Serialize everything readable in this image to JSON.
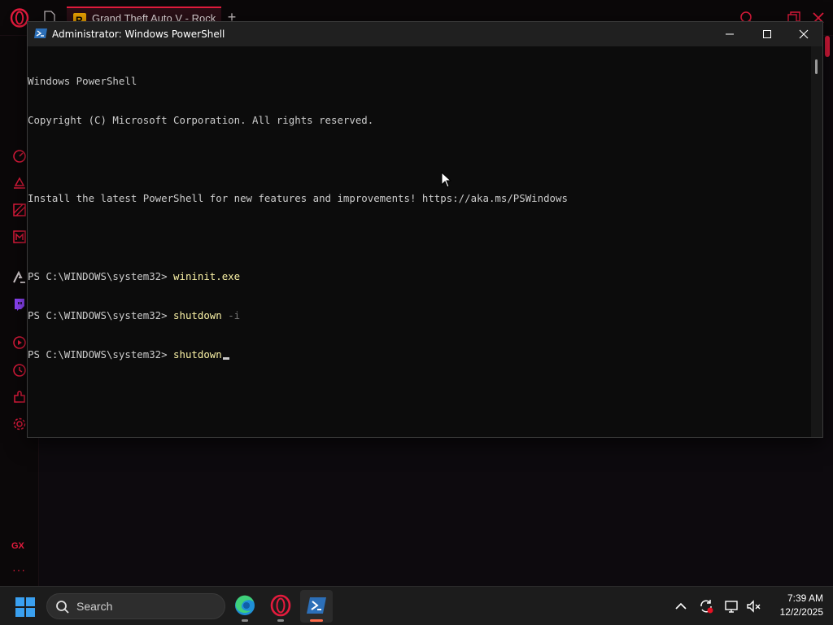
{
  "browser": {
    "tab_title": "Grand Theft Auto V - Rock",
    "new_tab": "+",
    "sidebar_gx": "GX",
    "sidebar_more": "···"
  },
  "powershell": {
    "window_title": "Administrator: Windows PowerShell",
    "lines": [
      "Windows PowerShell",
      "Copyright (C) Microsoft Corporation. All rights reserved.",
      "",
      "Install the latest PowerShell for new features and improvements! https://aka.ms/PSWindows",
      ""
    ],
    "prompt": "PS C:\\WINDOWS\\system32> ",
    "commands": [
      {
        "cmd": "wininit.exe",
        "param": ""
      },
      {
        "cmd": "shutdown",
        "param": " -i"
      },
      {
        "cmd": "shutdown",
        "param": ""
      }
    ]
  },
  "taskbar": {
    "search_label": "Search",
    "clock_time": "7:39 AM",
    "clock_date": "12/2/2025"
  },
  "colors": {
    "opera_red": "#e41b3d",
    "ps_command": "#f9f1a5",
    "ps_param": "#767676",
    "console_bg": "#0c0c0c"
  }
}
